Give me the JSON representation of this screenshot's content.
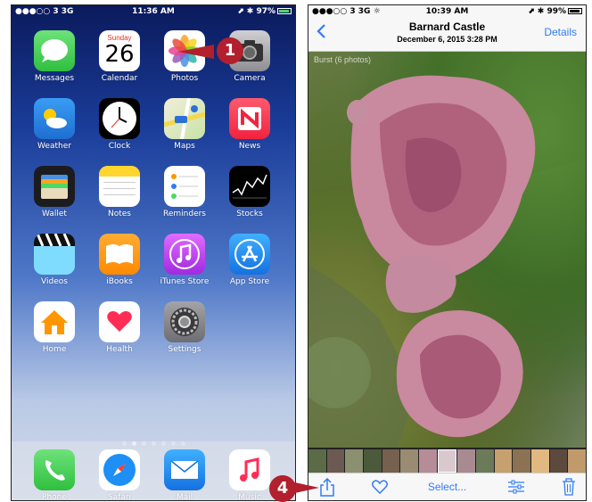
{
  "left_phone": {
    "status": {
      "carrier": "●●●○○ 3  3G",
      "time": "11:36 AM",
      "battery": "⬈ ✱ 97%"
    },
    "apps": [
      {
        "label": "Messages",
        "icon": "messages-icon",
        "color": "#4cd964"
      },
      {
        "label": "Calendar",
        "icon": "calendar-icon",
        "color": "#ffffff",
        "day": "Sunday",
        "date": "26"
      },
      {
        "label": "Photos",
        "icon": "photos-icon",
        "color": "#ffffff"
      },
      {
        "label": "Camera",
        "icon": "camera-icon",
        "color": "#8e8e93"
      },
      {
        "label": "Weather",
        "icon": "weather-icon",
        "color": "#2a8ce8"
      },
      {
        "label": "Clock",
        "icon": "clock-icon",
        "color": "#000000"
      },
      {
        "label": "Maps",
        "icon": "maps-icon",
        "color": "#e8e2c8"
      },
      {
        "label": "News",
        "icon": "news-icon",
        "color": "#fc3d57"
      },
      {
        "label": "Wallet",
        "icon": "wallet-icon",
        "color": "#1c1c1e"
      },
      {
        "label": "Notes",
        "icon": "notes-icon",
        "color": "#ffd52e"
      },
      {
        "label": "Reminders",
        "icon": "reminders-icon",
        "color": "#ffffff"
      },
      {
        "label": "Stocks",
        "icon": "stocks-icon",
        "color": "#000000"
      },
      {
        "label": "Videos",
        "icon": "videos-icon",
        "color": "#32c5ff"
      },
      {
        "label": "iBooks",
        "icon": "ibooks-icon",
        "color": "#ff9500"
      },
      {
        "label": "iTunes Store",
        "icon": "itunes-store-icon",
        "color": "#c643fc"
      },
      {
        "label": "App Store",
        "icon": "app-store-icon",
        "color": "#1d8ff5"
      },
      {
        "label": "Home",
        "icon": "home-icon",
        "color": "#ffffff"
      },
      {
        "label": "Health",
        "icon": "health-icon",
        "color": "#ffffff"
      },
      {
        "label": "Settings",
        "icon": "settings-icon",
        "color": "#8e8e93"
      }
    ],
    "page_dots": 7,
    "active_dot": 1,
    "dock": [
      {
        "label": "Phone",
        "icon": "phone-icon",
        "color": "#4cd964"
      },
      {
        "label": "Safari",
        "icon": "safari-icon",
        "color": "#ffffff"
      },
      {
        "label": "Mail",
        "icon": "mail-icon",
        "color": "#1d8ff5"
      },
      {
        "label": "Music",
        "icon": "music-icon",
        "color": "#ffffff"
      }
    ],
    "callout": "1"
  },
  "right_phone": {
    "status": {
      "carrier": "●●●○○ 3  3G ☼",
      "time": "10:39 AM",
      "battery": "⬈ ✱ 99%"
    },
    "title": "Barnard Castle",
    "subtitle": "December 6, 2015  3:28 PM",
    "details_label": "Details",
    "burst_label": "Burst (6 photos)",
    "toolbar": {
      "select_label": "Select..."
    },
    "callout": "4"
  }
}
